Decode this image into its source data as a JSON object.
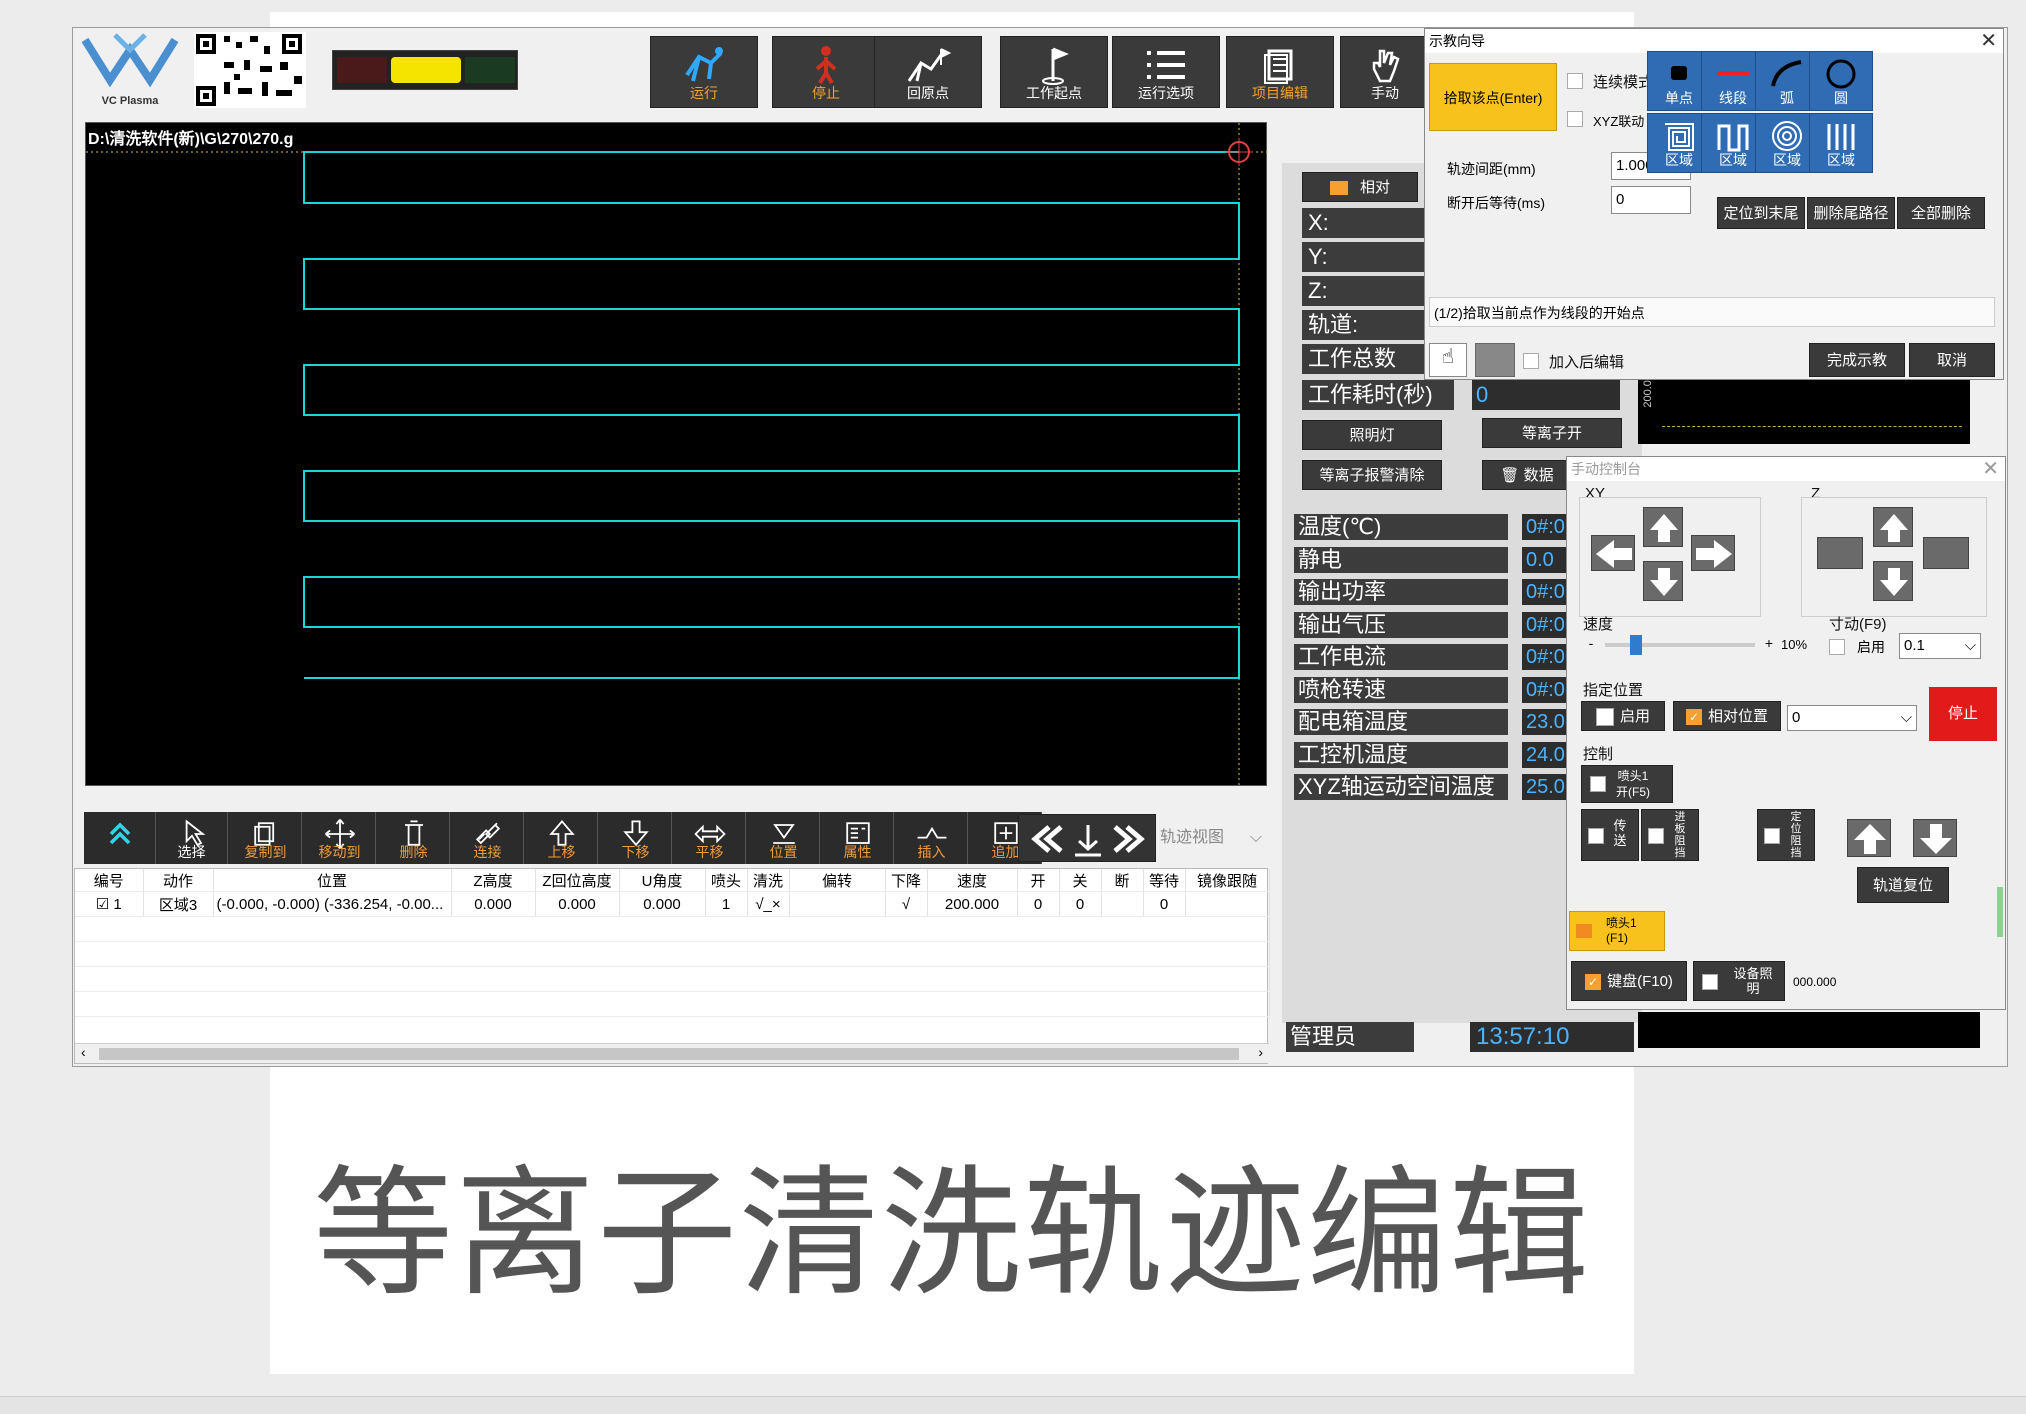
{
  "slide_title": "等离子清洗轨迹编辑",
  "footer_text": "",
  "logo": {
    "text": "VC Plasma"
  },
  "toolbar": [
    {
      "label": "运行",
      "icon": "run-icon",
      "highlight": true
    },
    {
      "label": "停止",
      "icon": "stop-person-icon",
      "highlight": true
    },
    {
      "label": "回原点",
      "icon": "home-origin-icon",
      "highlight": false
    },
    {
      "label": "工作起点",
      "icon": "flag-icon",
      "highlight": false
    },
    {
      "label": "运行选项",
      "icon": "list-icon",
      "highlight": false
    },
    {
      "label": "项目编辑",
      "icon": "document-icon",
      "highlight": true
    },
    {
      "label": "手动",
      "icon": "hand-icon",
      "highlight": false
    }
  ],
  "canvas": {
    "file_path": "D:\\清洗软件(新)\\G\\270\\270.g"
  },
  "edit_toolbar": [
    {
      "label": "",
      "icon": "collapse-up-icon"
    },
    {
      "label": "选择",
      "icon": "cursor-icon",
      "o": false
    },
    {
      "label": "复制到",
      "icon": "copy-icon",
      "o": true
    },
    {
      "label": "移动到",
      "icon": "move-icon",
      "o": true
    },
    {
      "label": "删除",
      "icon": "trash-icon",
      "o": true
    },
    {
      "label": "连接",
      "icon": "link-icon",
      "o": true
    },
    {
      "label": "上移",
      "icon": "arrow-up-icon",
      "o": true
    },
    {
      "label": "下移",
      "icon": "arrow-down-icon",
      "o": true
    },
    {
      "label": "平移",
      "icon": "pan-icon",
      "o": true
    },
    {
      "label": "位置",
      "icon": "position-icon",
      "o": true
    },
    {
      "label": "属性",
      "icon": "properties-icon",
      "o": true
    },
    {
      "label": "插入",
      "icon": "insert-icon",
      "o": true
    },
    {
      "label": "追加",
      "icon": "append-icon",
      "o": true
    }
  ],
  "track_view": {
    "label": "轨迹视图"
  },
  "table": {
    "headers": [
      "编号",
      "动作",
      "位置",
      "Z高度",
      "Z回位高度",
      "U角度",
      "喷头",
      "清洗",
      "偏转",
      "下降",
      "速度",
      "开",
      "关",
      "断",
      "等待",
      "镜像跟随"
    ],
    "rows": [
      [
        "1",
        "区域3",
        "(-0.000, -0.000) (-336.254, -0.00...",
        "0.000",
        "0.000",
        "0.000",
        "1",
        "√_×",
        "",
        "√",
        "200.000",
        "0",
        "0",
        "",
        "0",
        ""
      ]
    ]
  },
  "status": {
    "relative_label": "相对",
    "axes": [
      {
        "label": "X:",
        "value": ""
      },
      {
        "label": "Y:",
        "value": ""
      },
      {
        "label": "Z:",
        "value": ""
      },
      {
        "label": "轨道:",
        "value": ""
      },
      {
        "label": "工作总数",
        "value": ""
      },
      {
        "label": "工作耗时(秒)",
        "value": "0"
      }
    ],
    "btn_light": "照明灯",
    "btn_plasma_on": "等离子开",
    "btn_alarm_clear": "等离子报警清除",
    "btn_data": "数据",
    "sensors": [
      {
        "label": "温度(℃)",
        "value": "0#:0"
      },
      {
        "label": "静电",
        "value": "0.0"
      },
      {
        "label": "输出功率",
        "value": "0#:0"
      },
      {
        "label": "输出气压",
        "value": "0#:0"
      },
      {
        "label": "工作电流",
        "value": "0#:0"
      },
      {
        "label": "喷枪转速",
        "value": "0#:0"
      },
      {
        "label": "配电箱温度",
        "value": "23.0"
      },
      {
        "label": "工控机温度",
        "value": "24.0"
      },
      {
        "label": "XYZ轴运动空间温度",
        "value": "25.0"
      }
    ],
    "user": "管理员",
    "time": "13:57:10",
    "mini_axis": "200.00"
  },
  "teach": {
    "title": "示教向导",
    "pick_point": "拾取该点(Enter)",
    "continuous_mode": "连续模式",
    "xyz_link": "XYZ联动",
    "track_spacing_label": "轨迹间距(mm)",
    "track_spacing_value": "1.000",
    "wait_label": "断开后等待(ms)",
    "wait_value": "0",
    "tiles": [
      {
        "label": "单点",
        "icon": "point-icon"
      },
      {
        "label": "线段",
        "icon": "line-segment-icon"
      },
      {
        "label": "弧",
        "icon": "arc-icon"
      },
      {
        "label": "圆",
        "icon": "circle-icon"
      },
      {
        "label": "区域",
        "icon": "spiral-square-icon"
      },
      {
        "label": "区域",
        "icon": "zigzag-icon"
      },
      {
        "label": "区域",
        "icon": "concentric-icon"
      },
      {
        "label": "区域",
        "icon": "parallel-lines-icon"
      }
    ],
    "btn_locate_end": "定位到末尾",
    "btn_delete_tail": "删除尾路径",
    "btn_delete_all": "全部删除",
    "hint": "(1/2)拾取当前点作为线段的开始点",
    "add_then_edit": "加入后编辑",
    "btn_finish": "完成示教",
    "btn_cancel": "取消"
  },
  "manual": {
    "title": "手动控制台",
    "xy_label": "XY",
    "z_label": "Z",
    "speed_label": "速度",
    "speed_minus": "-",
    "speed_plus": "+",
    "speed_value": "10%",
    "speed_fraction": 0.1,
    "jog_label": "寸动(F9)",
    "jog_enable": "启用",
    "jog_value": "0.1",
    "pos_label": "指定位置",
    "pos_enable": "启用",
    "pos_relative": "相对位置",
    "pos_value": "0",
    "stop_btn": "停止",
    "control_label": "控制",
    "nozzle_open": "喷头1\n开(F5)",
    "transfer": "传送",
    "in_board_block": "进板阻挡",
    "positioning_block": "定位阻挡",
    "track_reset": "轨道复位",
    "nozzle_f1": "喷头1\n(F1)",
    "keyboard": "键盘(F10)",
    "device_light": "设备照明",
    "readout": "000.000"
  },
  "colors": {
    "accent_orange": "#f6a032",
    "tile_blue": "#2f6cb3",
    "trace_cyan": "#1ad7d7",
    "stop_red": "#e21a1a"
  }
}
